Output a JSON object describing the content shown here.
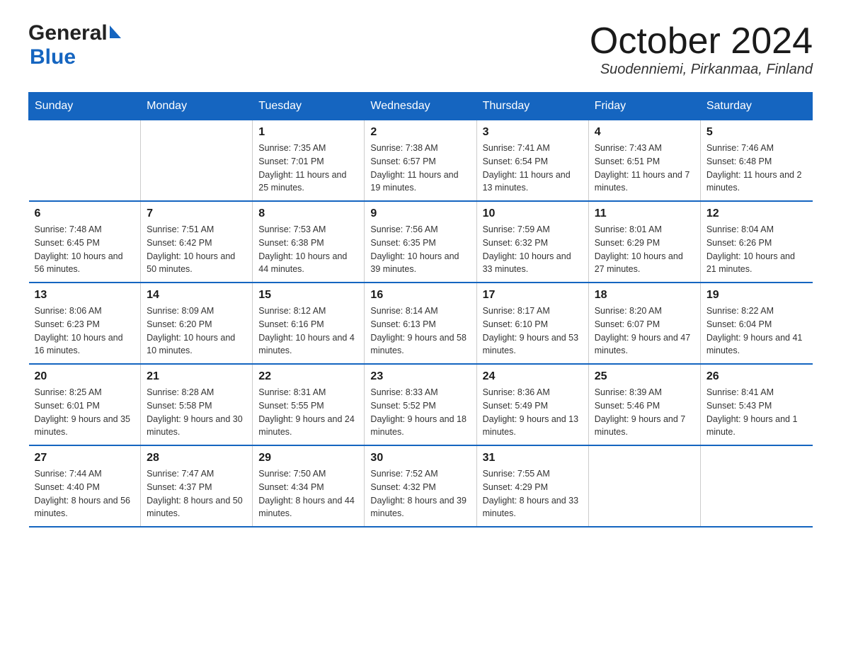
{
  "header": {
    "logo_general": "General",
    "logo_blue": "Blue",
    "month_year": "October 2024",
    "location": "Suodenniemi, Pirkanmaa, Finland"
  },
  "weekdays": [
    "Sunday",
    "Monday",
    "Tuesday",
    "Wednesday",
    "Thursday",
    "Friday",
    "Saturday"
  ],
  "weeks": [
    [
      {
        "day": "",
        "sunrise": "",
        "sunset": "",
        "daylight": ""
      },
      {
        "day": "",
        "sunrise": "",
        "sunset": "",
        "daylight": ""
      },
      {
        "day": "1",
        "sunrise": "Sunrise: 7:35 AM",
        "sunset": "Sunset: 7:01 PM",
        "daylight": "Daylight: 11 hours and 25 minutes."
      },
      {
        "day": "2",
        "sunrise": "Sunrise: 7:38 AM",
        "sunset": "Sunset: 6:57 PM",
        "daylight": "Daylight: 11 hours and 19 minutes."
      },
      {
        "day": "3",
        "sunrise": "Sunrise: 7:41 AM",
        "sunset": "Sunset: 6:54 PM",
        "daylight": "Daylight: 11 hours and 13 minutes."
      },
      {
        "day": "4",
        "sunrise": "Sunrise: 7:43 AM",
        "sunset": "Sunset: 6:51 PM",
        "daylight": "Daylight: 11 hours and 7 minutes."
      },
      {
        "day": "5",
        "sunrise": "Sunrise: 7:46 AM",
        "sunset": "Sunset: 6:48 PM",
        "daylight": "Daylight: 11 hours and 2 minutes."
      }
    ],
    [
      {
        "day": "6",
        "sunrise": "Sunrise: 7:48 AM",
        "sunset": "Sunset: 6:45 PM",
        "daylight": "Daylight: 10 hours and 56 minutes."
      },
      {
        "day": "7",
        "sunrise": "Sunrise: 7:51 AM",
        "sunset": "Sunset: 6:42 PM",
        "daylight": "Daylight: 10 hours and 50 minutes."
      },
      {
        "day": "8",
        "sunrise": "Sunrise: 7:53 AM",
        "sunset": "Sunset: 6:38 PM",
        "daylight": "Daylight: 10 hours and 44 minutes."
      },
      {
        "day": "9",
        "sunrise": "Sunrise: 7:56 AM",
        "sunset": "Sunset: 6:35 PM",
        "daylight": "Daylight: 10 hours and 39 minutes."
      },
      {
        "day": "10",
        "sunrise": "Sunrise: 7:59 AM",
        "sunset": "Sunset: 6:32 PM",
        "daylight": "Daylight: 10 hours and 33 minutes."
      },
      {
        "day": "11",
        "sunrise": "Sunrise: 8:01 AM",
        "sunset": "Sunset: 6:29 PM",
        "daylight": "Daylight: 10 hours and 27 minutes."
      },
      {
        "day": "12",
        "sunrise": "Sunrise: 8:04 AM",
        "sunset": "Sunset: 6:26 PM",
        "daylight": "Daylight: 10 hours and 21 minutes."
      }
    ],
    [
      {
        "day": "13",
        "sunrise": "Sunrise: 8:06 AM",
        "sunset": "Sunset: 6:23 PM",
        "daylight": "Daylight: 10 hours and 16 minutes."
      },
      {
        "day": "14",
        "sunrise": "Sunrise: 8:09 AM",
        "sunset": "Sunset: 6:20 PM",
        "daylight": "Daylight: 10 hours and 10 minutes."
      },
      {
        "day": "15",
        "sunrise": "Sunrise: 8:12 AM",
        "sunset": "Sunset: 6:16 PM",
        "daylight": "Daylight: 10 hours and 4 minutes."
      },
      {
        "day": "16",
        "sunrise": "Sunrise: 8:14 AM",
        "sunset": "Sunset: 6:13 PM",
        "daylight": "Daylight: 9 hours and 58 minutes."
      },
      {
        "day": "17",
        "sunrise": "Sunrise: 8:17 AM",
        "sunset": "Sunset: 6:10 PM",
        "daylight": "Daylight: 9 hours and 53 minutes."
      },
      {
        "day": "18",
        "sunrise": "Sunrise: 8:20 AM",
        "sunset": "Sunset: 6:07 PM",
        "daylight": "Daylight: 9 hours and 47 minutes."
      },
      {
        "day": "19",
        "sunrise": "Sunrise: 8:22 AM",
        "sunset": "Sunset: 6:04 PM",
        "daylight": "Daylight: 9 hours and 41 minutes."
      }
    ],
    [
      {
        "day": "20",
        "sunrise": "Sunrise: 8:25 AM",
        "sunset": "Sunset: 6:01 PM",
        "daylight": "Daylight: 9 hours and 35 minutes."
      },
      {
        "day": "21",
        "sunrise": "Sunrise: 8:28 AM",
        "sunset": "Sunset: 5:58 PM",
        "daylight": "Daylight: 9 hours and 30 minutes."
      },
      {
        "day": "22",
        "sunrise": "Sunrise: 8:31 AM",
        "sunset": "Sunset: 5:55 PM",
        "daylight": "Daylight: 9 hours and 24 minutes."
      },
      {
        "day": "23",
        "sunrise": "Sunrise: 8:33 AM",
        "sunset": "Sunset: 5:52 PM",
        "daylight": "Daylight: 9 hours and 18 minutes."
      },
      {
        "day": "24",
        "sunrise": "Sunrise: 8:36 AM",
        "sunset": "Sunset: 5:49 PM",
        "daylight": "Daylight: 9 hours and 13 minutes."
      },
      {
        "day": "25",
        "sunrise": "Sunrise: 8:39 AM",
        "sunset": "Sunset: 5:46 PM",
        "daylight": "Daylight: 9 hours and 7 minutes."
      },
      {
        "day": "26",
        "sunrise": "Sunrise: 8:41 AM",
        "sunset": "Sunset: 5:43 PM",
        "daylight": "Daylight: 9 hours and 1 minute."
      }
    ],
    [
      {
        "day": "27",
        "sunrise": "Sunrise: 7:44 AM",
        "sunset": "Sunset: 4:40 PM",
        "daylight": "Daylight: 8 hours and 56 minutes."
      },
      {
        "day": "28",
        "sunrise": "Sunrise: 7:47 AM",
        "sunset": "Sunset: 4:37 PM",
        "daylight": "Daylight: 8 hours and 50 minutes."
      },
      {
        "day": "29",
        "sunrise": "Sunrise: 7:50 AM",
        "sunset": "Sunset: 4:34 PM",
        "daylight": "Daylight: 8 hours and 44 minutes."
      },
      {
        "day": "30",
        "sunrise": "Sunrise: 7:52 AM",
        "sunset": "Sunset: 4:32 PM",
        "daylight": "Daylight: 8 hours and 39 minutes."
      },
      {
        "day": "31",
        "sunrise": "Sunrise: 7:55 AM",
        "sunset": "Sunset: 4:29 PM",
        "daylight": "Daylight: 8 hours and 33 minutes."
      },
      {
        "day": "",
        "sunrise": "",
        "sunset": "",
        "daylight": ""
      },
      {
        "day": "",
        "sunrise": "",
        "sunset": "",
        "daylight": ""
      }
    ]
  ]
}
